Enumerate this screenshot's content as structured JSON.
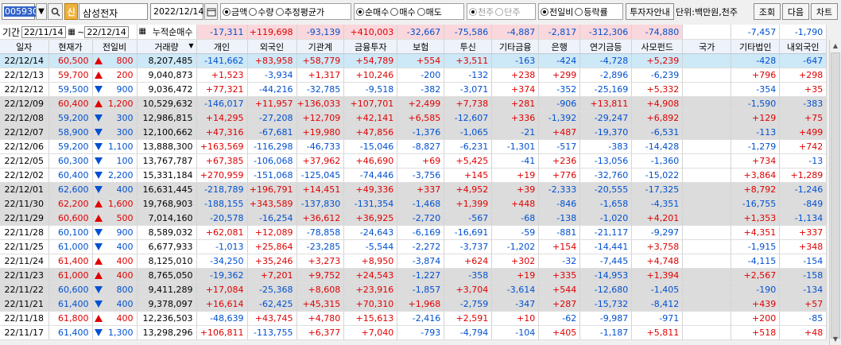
{
  "toolbar": {
    "stock_code": "005930",
    "search_icon": "search-icon",
    "shin_badge": "신",
    "stock_name": "삼성전자",
    "date": "2022/12/14",
    "measure_options": [
      {
        "label": "금액",
        "checked": true
      },
      {
        "label": "수량",
        "checked": false
      },
      {
        "label": "추정평균가",
        "checked": false
      }
    ],
    "trade_options": [
      {
        "label": "순매수",
        "checked": true
      },
      {
        "label": "매수",
        "checked": false
      },
      {
        "label": "매도",
        "checked": false
      }
    ],
    "unit_options": [
      {
        "label": "천주",
        "checked": true
      },
      {
        "label": "단주",
        "checked": false
      }
    ],
    "compare_options": [
      {
        "label": "전일비",
        "checked": true
      },
      {
        "label": "등락률",
        "checked": false
      }
    ],
    "investor_guide_label": "투자자안내",
    "unit_text": "단위:백만원,천주",
    "query_label": "조회",
    "next_label": "다음",
    "chart_label": "차트"
  },
  "period": {
    "label": "기간",
    "from": "22/11/14",
    "to": "22/12/14",
    "sep": "~"
  },
  "summary": {
    "label": "누적순매수",
    "values": [
      "-17,311",
      "+119,698",
      "-93,139",
      "+410,003",
      "-32,667",
      "-75,586",
      "-4,887",
      "-2,817",
      "-312,306",
      "-74,880",
      "",
      "-7,457",
      "-1,790"
    ]
  },
  "headers": [
    "일자",
    "현재가",
    "전일비",
    "거래량",
    "개인",
    "외국인",
    "기관계",
    "금융투자",
    "보험",
    "투신",
    "기타금융",
    "은행",
    "연기금등",
    "사모펀드",
    "국가",
    "기타법인",
    "내외국인"
  ],
  "rows": [
    {
      "date": "22/12/14",
      "price": "60,500",
      "dir": "up",
      "chg": "800",
      "vol": "8,207,485",
      "vals": [
        "-141,662",
        "+83,958",
        "+58,779",
        "+54,789",
        "+554",
        "+3,511",
        "-163",
        "-424",
        "-4,728",
        "+5,239",
        "",
        "-428",
        "-647"
      ]
    },
    {
      "date": "22/12/13",
      "price": "59,700",
      "dir": "up",
      "chg": "200",
      "vol": "9,040,873",
      "vals": [
        "+1,523",
        "-3,934",
        "+1,317",
        "+10,246",
        "-200",
        "-132",
        "+238",
        "+299",
        "-2,896",
        "-6,239",
        "",
        "+796",
        "+298"
      ]
    },
    {
      "date": "22/12/12",
      "price": "59,500",
      "dir": "down",
      "chg": "900",
      "vol": "9,036,472",
      "vals": [
        "+77,321",
        "-44,216",
        "-32,785",
        "-9,518",
        "-382",
        "-3,071",
        "+374",
        "-352",
        "-25,169",
        "+5,332",
        "",
        "-354",
        "+35"
      ]
    },
    {
      "date": "22/12/09",
      "price": "60,400",
      "dir": "up",
      "chg": "1,200",
      "vol": "10,529,632",
      "vals": [
        "-146,017",
        "+11,957",
        "+136,033",
        "+107,701",
        "+2,499",
        "+7,738",
        "+281",
        "-906",
        "+13,811",
        "+4,908",
        "",
        "-1,590",
        "-383"
      ]
    },
    {
      "date": "22/12/08",
      "price": "59,200",
      "dir": "down",
      "chg": "300",
      "vol": "12,986,815",
      "vals": [
        "+14,295",
        "-27,208",
        "+12,709",
        "+42,141",
        "+6,585",
        "-12,607",
        "+336",
        "-1,392",
        "-29,247",
        "+6,892",
        "",
        "+129",
        "+75"
      ]
    },
    {
      "date": "22/12/07",
      "price": "58,900",
      "dir": "down",
      "chg": "300",
      "vol": "12,100,662",
      "vals": [
        "+47,316",
        "-67,681",
        "+19,980",
        "+47,856",
        "-1,376",
        "-1,065",
        "-21",
        "+487",
        "-19,370",
        "-6,531",
        "",
        "-113",
        "+499"
      ]
    },
    {
      "date": "22/12/06",
      "price": "59,200",
      "dir": "down",
      "chg": "1,100",
      "vol": "13,888,300",
      "vals": [
        "+163,569",
        "-116,298",
        "-46,733",
        "-15,046",
        "-8,827",
        "-6,231",
        "-1,301",
        "-517",
        "-383",
        "-14,428",
        "",
        "-1,279",
        "+742"
      ]
    },
    {
      "date": "22/12/05",
      "price": "60,300",
      "dir": "down",
      "chg": "100",
      "vol": "13,767,787",
      "vals": [
        "+67,385",
        "-106,068",
        "+37,962",
        "+46,690",
        "+69",
        "+5,425",
        "-41",
        "+236",
        "-13,056",
        "-1,360",
        "",
        "+734",
        "-13"
      ]
    },
    {
      "date": "22/12/02",
      "price": "60,400",
      "dir": "down",
      "chg": "2,200",
      "vol": "15,331,184",
      "vals": [
        "+270,959",
        "-151,068",
        "-125,045",
        "-74,446",
        "-3,756",
        "+145",
        "+19",
        "+776",
        "-32,760",
        "-15,022",
        "",
        "+3,864",
        "+1,289"
      ]
    },
    {
      "date": "22/12/01",
      "price": "62,600",
      "dir": "down",
      "chg": "400",
      "vol": "16,631,445",
      "vals": [
        "-218,789",
        "+196,791",
        "+14,451",
        "+49,336",
        "+337",
        "+4,952",
        "+39",
        "-2,333",
        "-20,555",
        "-17,325",
        "",
        "+8,792",
        "-1,246"
      ]
    },
    {
      "date": "22/11/30",
      "price": "62,200",
      "dir": "up",
      "chg": "1,600",
      "vol": "19,768,903",
      "vals": [
        "-188,155",
        "+343,589",
        "-137,830",
        "-131,354",
        "-1,468",
        "+1,399",
        "+448",
        "-846",
        "-1,658",
        "-4,351",
        "",
        "-16,755",
        "-849"
      ]
    },
    {
      "date": "22/11/29",
      "price": "60,600",
      "dir": "up",
      "chg": "500",
      "vol": "7,014,160",
      "vals": [
        "-20,578",
        "-16,254",
        "+36,612",
        "+36,925",
        "-2,720",
        "-567",
        "-68",
        "-138",
        "-1,020",
        "+4,201",
        "",
        "+1,353",
        "-1,134"
      ]
    },
    {
      "date": "22/11/28",
      "price": "60,100",
      "dir": "down",
      "chg": "900",
      "vol": "8,589,032",
      "vals": [
        "+62,081",
        "+12,089",
        "-78,858",
        "-24,643",
        "-6,169",
        "-16,691",
        "-59",
        "-881",
        "-21,117",
        "-9,297",
        "",
        "+4,351",
        "+337"
      ]
    },
    {
      "date": "22/11/25",
      "price": "61,000",
      "dir": "down",
      "chg": "400",
      "vol": "6,677,933",
      "vals": [
        "-1,013",
        "+25,864",
        "-23,285",
        "-5,544",
        "-2,272",
        "-3,737",
        "-1,202",
        "+154",
        "-14,441",
        "+3,758",
        "",
        "-1,915",
        "+348"
      ]
    },
    {
      "date": "22/11/24",
      "price": "61,400",
      "dir": "up",
      "chg": "400",
      "vol": "8,125,010",
      "vals": [
        "-34,250",
        "+35,246",
        "+3,273",
        "+8,950",
        "-3,874",
        "+624",
        "+302",
        "-32",
        "-7,445",
        "+4,748",
        "",
        "-4,115",
        "-154"
      ]
    },
    {
      "date": "22/11/23",
      "price": "61,000",
      "dir": "up",
      "chg": "400",
      "vol": "8,765,050",
      "vals": [
        "-19,362",
        "+7,201",
        "+9,752",
        "+24,543",
        "-1,227",
        "-358",
        "+19",
        "+335",
        "-14,953",
        "+1,394",
        "",
        "+2,567",
        "-158"
      ]
    },
    {
      "date": "22/11/22",
      "price": "60,600",
      "dir": "down",
      "chg": "800",
      "vol": "9,411,289",
      "vals": [
        "+17,084",
        "-25,368",
        "+8,608",
        "+23,916",
        "-1,857",
        "+3,704",
        "-3,614",
        "+544",
        "-12,680",
        "-1,405",
        "",
        "-190",
        "-134"
      ]
    },
    {
      "date": "22/11/21",
      "price": "61,400",
      "dir": "down",
      "chg": "400",
      "vol": "9,378,097",
      "vals": [
        "+16,614",
        "-62,425",
        "+45,315",
        "+70,310",
        "+1,968",
        "-2,759",
        "-347",
        "+287",
        "-15,732",
        "-8,412",
        "",
        "+439",
        "+57"
      ]
    },
    {
      "date": "22/11/18",
      "price": "61,800",
      "dir": "up",
      "chg": "400",
      "vol": "12,236,503",
      "vals": [
        "-48,639",
        "+43,745",
        "+4,780",
        "+15,613",
        "-2,416",
        "+2,591",
        "+10",
        "-62",
        "-9,987",
        "-971",
        "",
        "+200",
        "-85"
      ]
    },
    {
      "date": "22/11/17",
      "price": "61,400",
      "dir": "down",
      "chg": "1,300",
      "vol": "13,298,296",
      "vals": [
        "+106,811",
        "-113,755",
        "+6,377",
        "+7,040",
        "-793",
        "-4,794",
        "-104",
        "+405",
        "-1,187",
        "+5,811",
        "",
        "+518",
        "+48"
      ]
    }
  ],
  "colors": {
    "up": "#e00000",
    "down": "#0050d0",
    "selected": "#cde8f6",
    "alt": "#dcdcdc",
    "header": "#eef2fa",
    "highlight": "#fad7dc"
  }
}
